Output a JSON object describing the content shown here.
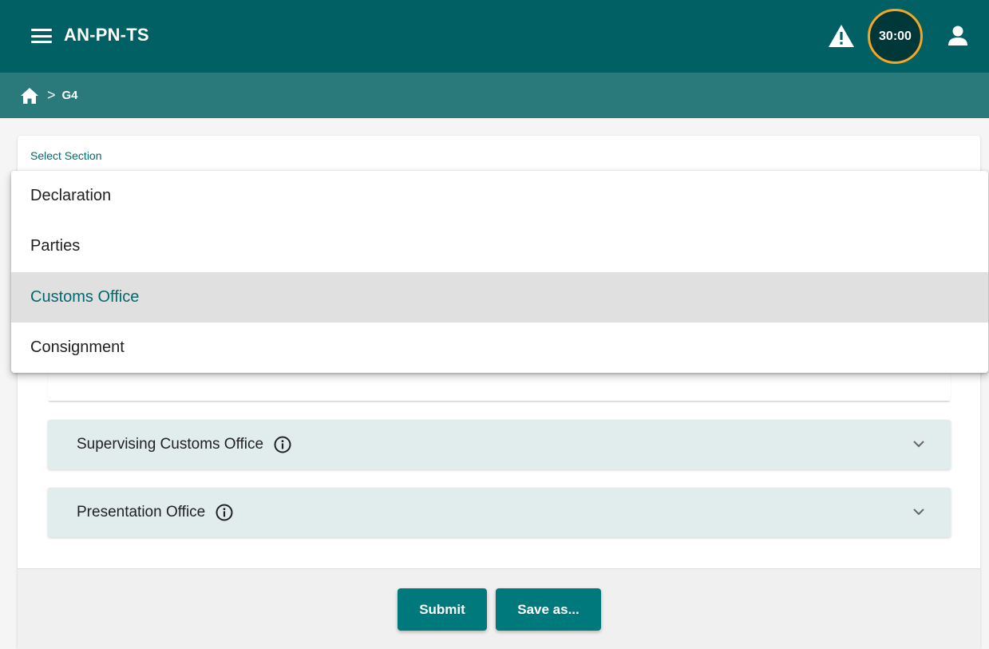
{
  "header": {
    "app_title": "AN-PN-TS",
    "timer": "30:00",
    "icons": [
      "menu-icon",
      "warning-icon",
      "user-icon"
    ],
    "brand_color": "#006064",
    "timer_ring_color": "#f5a623"
  },
  "breadcrumb": {
    "home_icon": "home-icon",
    "separator": ">",
    "current": "G4"
  },
  "form": {
    "select_label": "Select Section",
    "sections": [
      {
        "label": "Declaration",
        "selected": false
      },
      {
        "label": "Parties",
        "selected": false
      },
      {
        "label": "Customs Office",
        "selected": true
      },
      {
        "label": "Consignment",
        "selected": false
      }
    ],
    "panels": [
      {
        "title": "Supervising Customs Office",
        "expanded": false
      },
      {
        "title": "Presentation Office",
        "expanded": false
      }
    ]
  },
  "footer": {
    "submit_label": "Submit",
    "save_as_label": "Save as..."
  }
}
